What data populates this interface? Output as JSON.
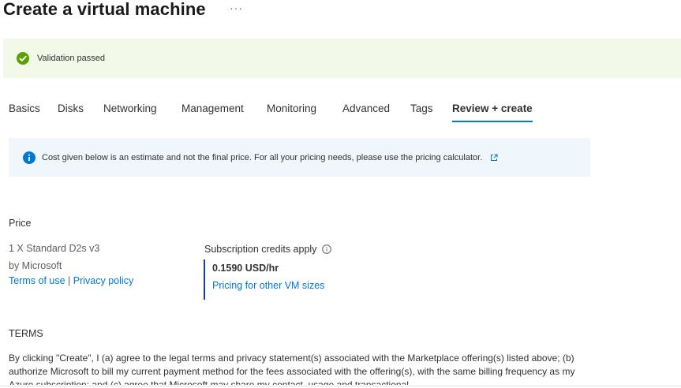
{
  "header": {
    "title": "Create a virtual machine",
    "more_label": "···"
  },
  "validation": {
    "message": "Validation passed",
    "status_color": "#57a300",
    "icon": "check-circle-icon"
  },
  "tabs": [
    {
      "label": "Basics",
      "active": false
    },
    {
      "label": "Disks",
      "active": false
    },
    {
      "label": "Networking",
      "active": false
    },
    {
      "label": "Management",
      "active": false
    },
    {
      "label": "Monitoring",
      "active": false
    },
    {
      "label": "Advanced",
      "active": false
    },
    {
      "label": "Tags",
      "active": false
    },
    {
      "label": "Review + create",
      "active": true
    }
  ],
  "info_banner": {
    "text": "Cost given below is an estimate and not the final price. For all your pricing needs, please use the pricing calculator.",
    "icon": "info-icon",
    "link_icon": "external-link-icon"
  },
  "price": {
    "heading": "Price",
    "product": "1 X Standard D2s v3",
    "publisher": "by Microsoft",
    "terms_link": "Terms of use",
    "separator": "|",
    "privacy_link": "Privacy policy",
    "credits_label": "Subscription credits apply",
    "rate": "0.1590 USD/hr",
    "other_sizes_link": "Pricing for other VM sizes"
  },
  "terms": {
    "heading": "TERMS",
    "body": "By clicking \"Create\", I (a) agree to the legal terms and privacy statement(s) associated with the Marketplace offering(s) listed above; (b) authorize Microsoft to bill my current payment method for the fees associated with the offering(s), with the same billing frequency as my Azure subscription; and (c) agree that Microsoft may share my contact, usage and transactional"
  },
  "colors": {
    "accent": "#0078d4",
    "success_bg": "#f3f9e9",
    "info_bg": "#eff6fc"
  }
}
